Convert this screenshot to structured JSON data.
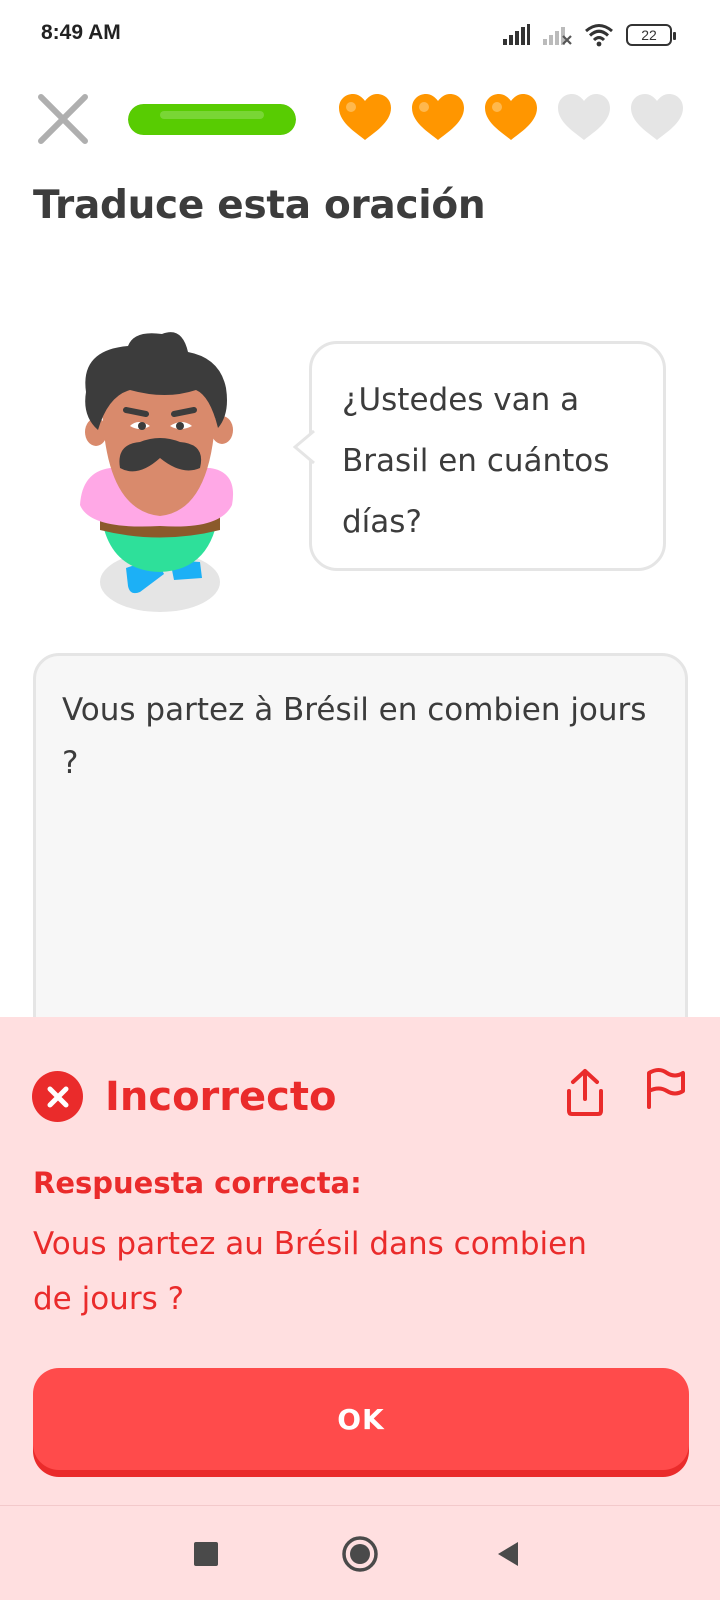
{
  "status_bar": {
    "time": "8:49 AM",
    "battery": "22",
    "icons": [
      "signal-icon",
      "signal-off-icon",
      "wifi-icon",
      "battery-icon"
    ]
  },
  "lesson": {
    "progress": 1.0,
    "hearts": {
      "filled": 3,
      "total": 5
    },
    "colors": {
      "progress": "#58cc02",
      "heart_full": "#ff9600",
      "heart_empty": "#e5e5e5"
    }
  },
  "prompt": {
    "title": "Traduce esta oración",
    "sentence": "¿Ustedes van a Brasil en cuántos días?"
  },
  "answer": {
    "value": "Vous partez à Brésil en combien jours ?"
  },
  "feedback": {
    "status": "Incorrecto",
    "label": "Respuesta correcta:",
    "correct_answer": "Vous partez au Brésil dans combien de jours ?",
    "button_label": "OK",
    "colors": {
      "background": "#ffdfe0",
      "accent": "#ea2b2b",
      "button": "#ff4b4b"
    }
  },
  "navigation": {
    "buttons": [
      "recents-icon",
      "home-icon",
      "back-icon"
    ]
  }
}
